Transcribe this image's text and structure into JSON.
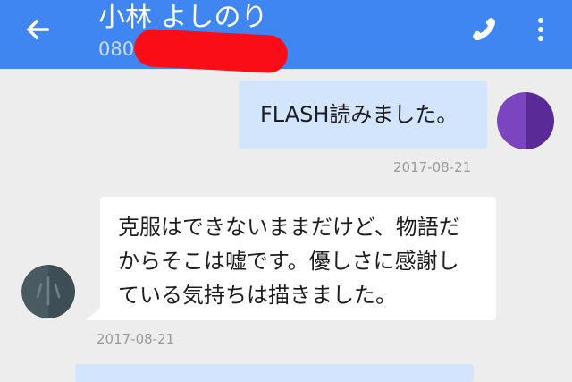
{
  "header": {
    "contact_name": "小林 よしのり",
    "contact_number_visible": "080",
    "accent_color": "#3f86f2",
    "icons": {
      "back": "arrow-left-icon",
      "phone": "phone-icon",
      "menu": "more-vert-icon"
    }
  },
  "messages": [
    {
      "direction": "outgoing",
      "text": "FLASH読みました。",
      "date": "2017-08-21",
      "bubble_color": "#d2e5fd"
    },
    {
      "direction": "incoming",
      "lines": [
        "克服はできないままだけど、物語だ",
        "からそこは嘘です。優しさに感謝し",
        "ている気持ちは描きました。"
      ],
      "date": "2017-08-21",
      "bubble_color": "#ffffff"
    }
  ]
}
